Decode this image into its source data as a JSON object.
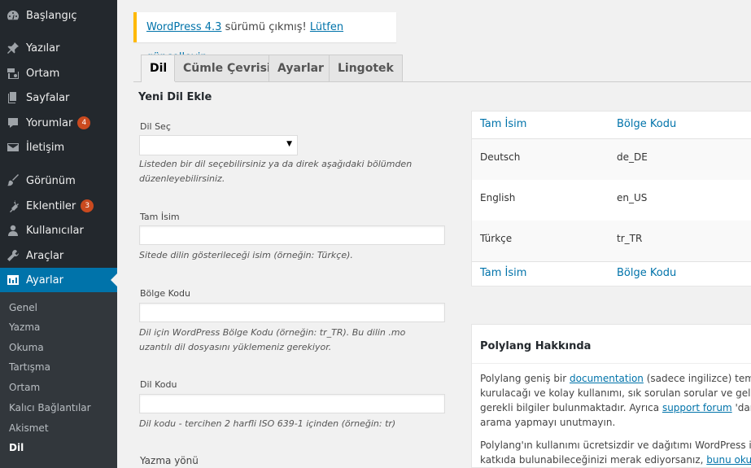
{
  "sidebar": {
    "items": [
      {
        "label": "Başlangıç",
        "icon": "dashboard-icon"
      },
      {
        "label": "Yazılar",
        "icon": "pin-icon"
      },
      {
        "label": "Ortam",
        "icon": "media-icon"
      },
      {
        "label": "Sayfalar",
        "icon": "pages-icon"
      },
      {
        "label": "Yorumlar",
        "icon": "comments-icon",
        "badge": "4"
      },
      {
        "label": "İletişim",
        "icon": "mail-icon"
      },
      {
        "label": "Görünüm",
        "icon": "brush-icon"
      },
      {
        "label": "Eklentiler",
        "icon": "plugin-icon",
        "badge": "3"
      },
      {
        "label": "Kullanıcılar",
        "icon": "user-icon"
      },
      {
        "label": "Araçlar",
        "icon": "wrench-icon"
      },
      {
        "label": "Ayarlar",
        "icon": "settings-icon"
      }
    ],
    "submenu": [
      "Genel",
      "Yazma",
      "Okuma",
      "Tartışma",
      "Ortam",
      "Kalıcı Bağlantılar",
      "Akismet",
      "Dil"
    ]
  },
  "notice": {
    "version_link": "WordPress 4.3",
    "middle_text": " sürümü çıkmış! ",
    "update_link": "Lütfen güncelleyin",
    "end_text": "."
  },
  "tabs": [
    "Dil",
    "Cümle Çevrisi",
    "Ayarlar",
    "Lingotek"
  ],
  "form": {
    "title": "Yeni Dil Ekle",
    "choose_label": "Dil Seç",
    "choose_value": "",
    "choose_desc": "Listeden bir dil seçebilirsiniz ya da direk aşağıdaki bölümden düzenleyebilirsiniz.",
    "fullname_label": "Tam İsim",
    "fullname_value": "",
    "fullname_desc": "Sitede dilin gösterileceği isim (örneğin: Türkçe).",
    "locale_label": "Bölge Kodu",
    "locale_value": "",
    "locale_desc": "Dil için WordPress Bölge Kodu (örneğin: tr_TR). Bu dilin .mo uzantılı dil dosyasını yüklemeniz gerekiyor.",
    "code_label": "Dil Kodu",
    "code_value": "",
    "code_desc": "Dil kodu - tercihen 2 harfli ISO 639-1 içinden (örneğin: tr)",
    "direction_label": "Yazma yönü"
  },
  "table": {
    "col_name": "Tam İsim",
    "col_locale": "Bölge Kodu",
    "rows": [
      {
        "name": "Deutsch",
        "locale": "de_DE"
      },
      {
        "name": "English",
        "locale": "en_US"
      },
      {
        "name": "Türkçe",
        "locale": "tr_TR"
      }
    ]
  },
  "about": {
    "title": "Polylang Hakkında",
    "p1_line1_a": "Polylang geniş bir ",
    "p1_link_doc": "documentation",
    "p1_line1_b": " (sadece ingilizce) temin",
    "p1_line2": "kurulacağı ve kolay kullanımı, sık sorulan sorular ve geliştir",
    "p1_line3_a": "gerekli bilgiler bulunmaktadır. Ayrıca ",
    "p1_link_forum": "support forum",
    "p1_line3_b": " 'dan d",
    "p1_line4": "arama yapmayı unutmayın.",
    "p2_line1": "Polylang'ın kullanımı ücretsizdir ve dağıtımı WordPress ile",
    "p2_line2_a": "katkıda bulunabileceğinizi merak ediyorsanız, ",
    "p2_link": "bunu okuyun"
  }
}
